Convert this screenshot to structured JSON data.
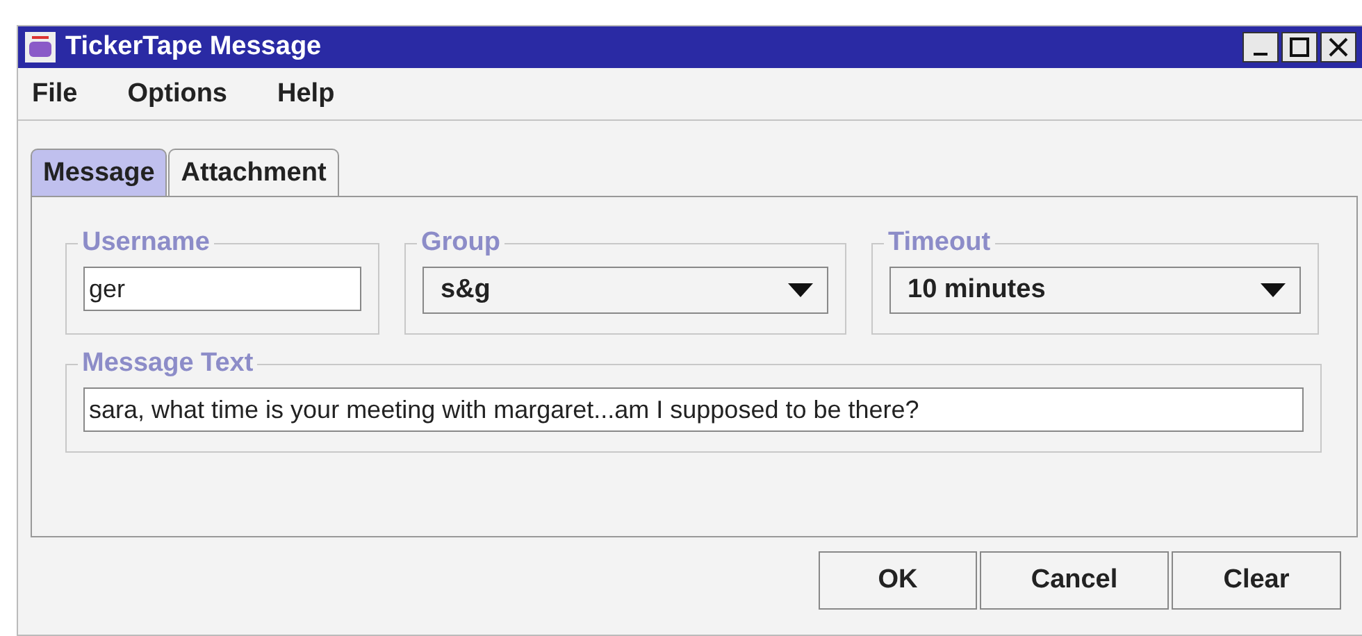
{
  "window": {
    "title": "TickerTape Message"
  },
  "menu": [
    "File",
    "Options",
    "Help"
  ],
  "tabs": [
    {
      "label": "Message",
      "selected": true
    },
    {
      "label": "Attachment",
      "selected": false
    }
  ],
  "fields": {
    "username": {
      "label": "Username",
      "value": "ger"
    },
    "group": {
      "label": "Group",
      "value": "s&g"
    },
    "timeout": {
      "label": "Timeout",
      "value": "10 minutes"
    },
    "message": {
      "label": "Message Text",
      "value": "sara, what time is your meeting with margaret...am I supposed to be there?"
    }
  },
  "buttons": [
    "OK",
    "Cancel",
    "Clear"
  ]
}
